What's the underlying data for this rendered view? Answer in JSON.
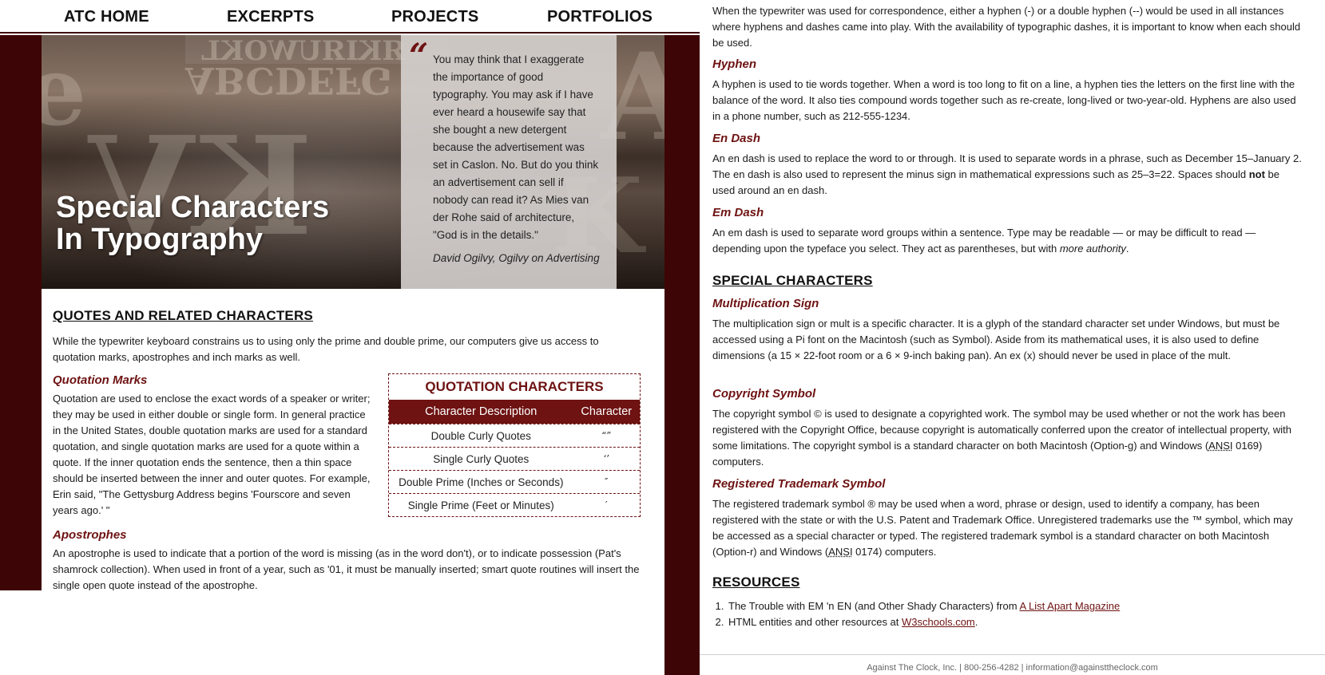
{
  "nav": {
    "items": [
      "ATC HOME",
      "EXCERPTS",
      "PROJECTS",
      "PORTFOLIOS"
    ]
  },
  "hero": {
    "title_line1": "Special Characters",
    "title_line2": "In Typography",
    "quote_mark": "“",
    "quote": "You may think that I exaggerate the importance of good typography. You may ask if I have ever heard a housewife say that she bought a new detergent because the advertisement was set in Caslon. No. But do you think an advertisement can sell if nobody can read it? As Mies van der Rohe said of architecture, \"God is in the details.\"",
    "author": "David Ogilvy, Ogilvy on Advertising"
  },
  "quotes_section": {
    "heading": "QUOTES AND RELATED CHARACTERS",
    "intro": "While the typewriter keyboard constrains us to using only the prime and double prime, our computers give us access to quotation marks, apostrophes and inch marks as well.",
    "quotation_marks_title": "Quotation Marks",
    "quotation_marks_body": "Quotation are used to enclose the exact words of a speaker or writer; they may be used in either double or single form. In general practice in the United States, double quotation marks are used for a standard quotation, and single quotation marks are used for a quote within a quote. If the inner quotation ends the sentence, then a thin space should be inserted between the inner and outer quotes. For example, Erin said, \"The Gettysburg Address begins 'Fourscore and seven years ago.' \"",
    "apostrophes_title": "Apostrophes",
    "apostrophes_body": "An apostrophe is used to indicate that a portion of the word is missing (as in the word don't), or to indicate possession (Pat's shamrock collection). When used in front of a year, such as '01, it must be manually inserted; smart quote routines will insert the single open quote instead of the apostrophe."
  },
  "quotation_table": {
    "caption": "QUOTATION CHARACTERS",
    "headers": [
      "Character Description",
      "Character"
    ],
    "rows": [
      [
        "Double Curly Quotes",
        "“”"
      ],
      [
        "Single Curly Quotes",
        "‘’"
      ],
      [
        "Double Prime (Inches or Seconds)",
        "″"
      ],
      [
        "Single Prime (Feet or Minutes)",
        "′"
      ]
    ]
  },
  "dashes": {
    "intro": "When the typewriter was used for correspondence, either a hyphen (-) or a double hyphen (--) would be used in all instances where hyphens and dashes came into play. With the availability of typographic dashes, it is important to know when each should be used.",
    "hyphen_title": "Hyphen",
    "hyphen_body": "A hyphen is used to tie words together. When a word is too long to fit on a line, a hyphen ties the letters on the first line with the balance of the word. It also ties compound words together such as re-create, long-lived or two-year-old. Hyphens are also used in a phone number, such as 212-555-1234.",
    "en_title": "En Dash",
    "en_body_1": "An en dash is used to replace the word to or through. It is used to separate words in a phrase, such as December 15–January 2. The en dash is also used to represent the minus sign in mathematical expressions such as 25–3=22. Spaces should ",
    "en_body_bold": "not",
    "en_body_2": " be used around an en dash.",
    "em_title": "Em Dash",
    "em_body_1": "An em dash is used to separate word groups within a sentence. Type may be readable — or may be difficult to read — depending upon the typeface you select. They act as parentheses, but with ",
    "em_body_italic": "more authority",
    "em_body_2": "."
  },
  "special": {
    "heading": "SPECIAL CHARACTERS",
    "mult_title": "Multiplication Sign",
    "mult_body": "The multiplication sign or mult is a specific character. It is a glyph of the standard character set under Windows, but must be accessed using a Pi font on the Macintosh (such as Symbol). Aside from its mathematical uses, it is also used to define dimensions (a 15 × 22-foot room or a 6 × 9-inch baking pan). An ex (x) should never be used in place of the mult.",
    "copyright_title": "Copyright Symbol",
    "copyright_body_1": "The copyright symbol © is used to designate a copyrighted work. The symbol may be used whether or not the work has been registered with the Copyright Office, because copyright is automatically conferred upon the creator of intellectual property, with some limitations. The copyright symbol is a standard character on both Macintosh (Option-g) and Windows (",
    "ansi": "ANSI",
    "copyright_body_2": " 0169) computers.",
    "registered_title": "Registered Trademark Symbol",
    "registered_body_1": "The registered trademark symbol ® may be used when a word, phrase or design, used to identify a company, has been registered with the state or with the U.S. Patent and Trademark Office. Unregistered trademarks use the ™ symbol, which may be accessed as a special character or typed. The registered trademark symbol is a standard character on both Macintosh (Option-r) and Windows (",
    "registered_body_2": " 0174) computers."
  },
  "resources": {
    "heading": "RESOURCES",
    "item1_text": "The Trouble with EM 'n EN (and Other Shady Characters) from ",
    "item1_link": "A List Apart Magazine",
    "item2_text": "HTML entities and other resources at ",
    "item2_link": "W3schools.com",
    "item2_end": "."
  },
  "footer": {
    "text": "Against The Clock, Inc. | 800-256-4282 | information@againsttheclock.com"
  },
  "colors": {
    "maroon_dark": "#3d0505",
    "maroon": "#6e1212"
  }
}
